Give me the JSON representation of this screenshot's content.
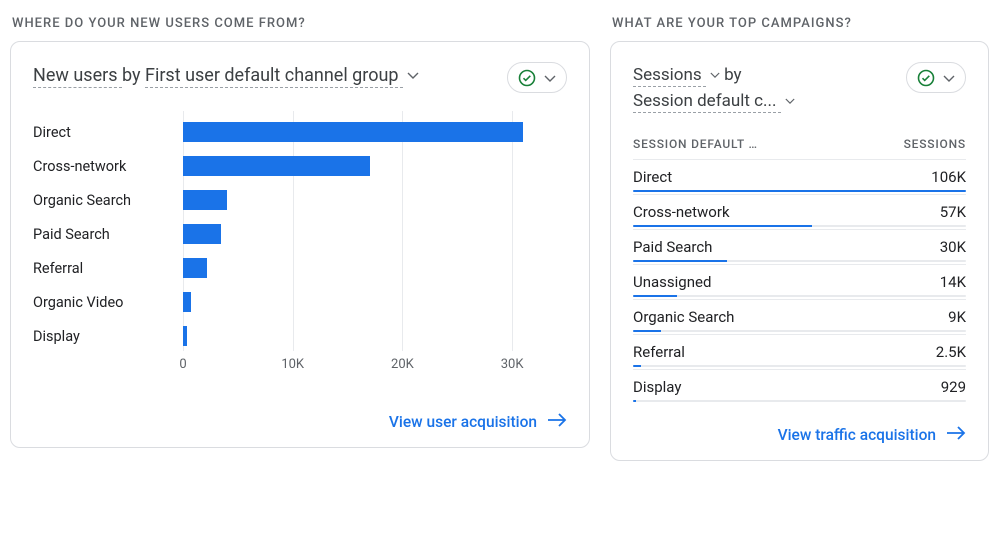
{
  "left": {
    "section_title": "WHERE DO YOUR NEW USERS COME FROM?",
    "selector": {
      "metric": "New users",
      "by": "by",
      "dimension": "First user default channel group"
    },
    "axis_max": 35000,
    "ticks": [
      {
        "pos": 0,
        "label": "0"
      },
      {
        "pos": 10000,
        "label": "10K"
      },
      {
        "pos": 20000,
        "label": "20K"
      },
      {
        "pos": 30000,
        "label": "30K"
      }
    ],
    "bars": [
      {
        "label": "Direct",
        "value": 31000
      },
      {
        "label": "Cross-network",
        "value": 17000
      },
      {
        "label": "Organic Search",
        "value": 4000
      },
      {
        "label": "Paid Search",
        "value": 3500
      },
      {
        "label": "Referral",
        "value": 2200
      },
      {
        "label": "Organic Video",
        "value": 700
      },
      {
        "label": "Display",
        "value": 400
      }
    ],
    "footer_link": "View user acquisition"
  },
  "right": {
    "section_title": "WHAT ARE YOUR TOP CAMPAIGNS?",
    "selector": {
      "metric": "Sessions",
      "by": "by",
      "dimension": "Session default c..."
    },
    "table": {
      "col1": "SESSION DEFAULT …",
      "col2": "SESSIONS",
      "max": 106000,
      "rows": [
        {
          "label": "Direct",
          "display": "106K",
          "value": 106000
        },
        {
          "label": "Cross-network",
          "display": "57K",
          "value": 57000
        },
        {
          "label": "Paid Search",
          "display": "30K",
          "value": 30000
        },
        {
          "label": "Unassigned",
          "display": "14K",
          "value": 14000
        },
        {
          "label": "Organic Search",
          "display": "9K",
          "value": 9000
        },
        {
          "label": "Referral",
          "display": "2.5K",
          "value": 2500
        },
        {
          "label": "Display",
          "display": "929",
          "value": 929
        }
      ]
    },
    "footer_link": "View traffic acquisition"
  },
  "chart_data": {
    "type": "bar",
    "title": "New users by First user default channel group",
    "orientation": "horizontal",
    "xlabel": "",
    "ylabel": "",
    "xlim": [
      0,
      35000
    ],
    "categories": [
      "Direct",
      "Cross-network",
      "Organic Search",
      "Paid Search",
      "Referral",
      "Organic Video",
      "Display"
    ],
    "values": [
      31000,
      17000,
      4000,
      3500,
      2200,
      700,
      400
    ],
    "ticks": [
      0,
      10000,
      20000,
      30000
    ]
  }
}
